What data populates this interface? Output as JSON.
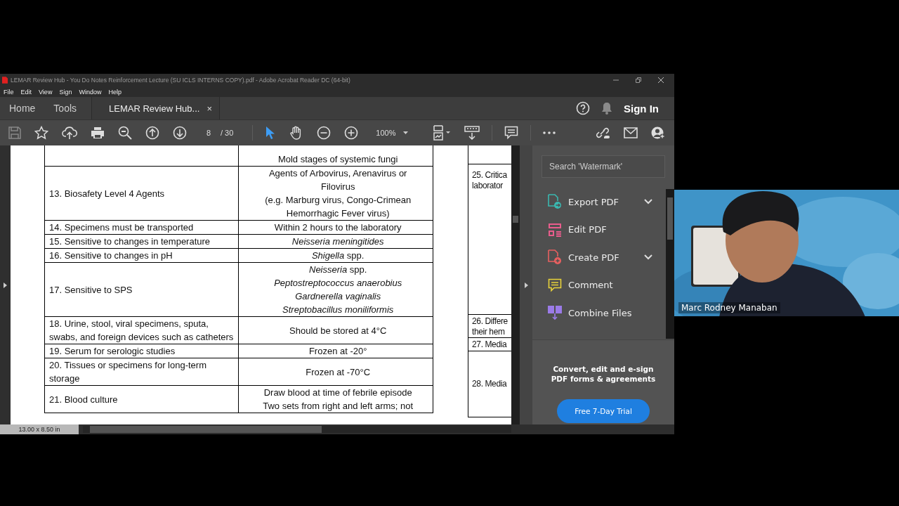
{
  "window": {
    "title": "LEMAR Review Hub - You Do Notes Reinforcement Lecture (SU ICLS INTERNS COPY).pdf - Adobe Acrobat Reader DC (64-bit)"
  },
  "menu": [
    "File",
    "Edit",
    "View",
    "Sign",
    "Window",
    "Help"
  ],
  "tabs": [
    {
      "label": "Home",
      "selected": false,
      "closable": false
    },
    {
      "label": "Tools",
      "selected": false,
      "closable": false
    },
    {
      "label": "LEMAR Review Hub...",
      "selected": true,
      "closable": true,
      "close": "×"
    }
  ],
  "sign_in": "Sign In",
  "toolbar": {
    "page": "8",
    "page_count": "/ 30",
    "zoom": "100%",
    "tools": [
      {
        "kind": "select",
        "selected": true
      },
      {
        "kind": "hand",
        "selected": false
      }
    ]
  },
  "table": {
    "rows": [
      {
        "answer": [
          {
            "text": "Mold stages of systemic fungi",
            "italic": false
          }
        ]
      },
      {
        "item": "13. Biosafety Level 4 Agents",
        "answer": [
          {
            "text": "Agents of Arbovirus, Arenavirus or",
            "italic": false
          },
          {
            "text": "Filovirus",
            "italic": false
          },
          {
            "text": "(e.g. Marburg virus, Congo-Crimean",
            "italic": false
          },
          {
            "text": "Hemorrhagic Fever virus)",
            "italic": false
          }
        ]
      },
      {
        "item": "14. Specimens must be transported",
        "answer": [
          {
            "text": "Within 2 hours to the laboratory",
            "italic": false
          }
        ]
      },
      {
        "item": "15. Sensitive to changes in temperature",
        "answer": [
          {
            "text": "Neisseria meningitides",
            "italic": true
          }
        ]
      },
      {
        "item": "16. Sensitive to changes in pH",
        "answer": [
          {
            "text": "*Shigella*  spp.",
            "italic": false
          }
        ]
      },
      {
        "item": "17. Sensitive to SPS",
        "answer": [
          {
            "text": "*Neisseria* spp.",
            "italic": false
          },
          {
            "text": "Peptostreptococcus anaerobius",
            "italic": true
          },
          {
            "text": "Gardnerella vaginalis",
            "italic": true
          },
          {
            "text": "Streptobacillus moniliformis",
            "italic": true
          }
        ]
      },
      {
        "item": "18. Urine, stool, viral specimens, sputa, swabs, and foreign devices such as catheters",
        "answer": [
          {
            "text": "Should be stored at 4°C",
            "italic": false
          }
        ]
      },
      {
        "item": "19. Serum for serologic studies",
        "answer": [
          {
            "text": "Frozen at -20°",
            "italic": false
          }
        ]
      },
      {
        "item": "20. Tissues or specimens for long-term storage",
        "answer": [
          {
            "text": "Frozen at -70°C",
            "italic": false
          }
        ]
      },
      {
        "item": "21. Blood culture",
        "answer": [
          {
            "text": "Draw blood at time of febrile episode",
            "italic": false
          },
          {
            "text": "Two sets from right and left arms; not",
            "italic": false
          }
        ]
      }
    ],
    "side_column": [
      {
        "lines": [
          "25. Critica",
          "laborator"
        ]
      },
      {
        "lines": [
          "26. Differe",
          "their hem"
        ]
      },
      {
        "lines": [
          "27. Media"
        ]
      },
      {
        "lines": [
          "28. Media"
        ]
      }
    ]
  },
  "page_size": "13.00 x 8.50 in",
  "tools_panel": {
    "search": {
      "placeholder": "Search 'Watermark'"
    },
    "items": [
      {
        "label": "Export PDF",
        "kind": "export",
        "color": "#3ab8b0",
        "expandable": true
      },
      {
        "label": "Edit PDF",
        "kind": "edit",
        "color": "#e85d8c",
        "expandable": false
      },
      {
        "label": "Create PDF",
        "kind": "create",
        "color": "#e86060",
        "expandable": true
      },
      {
        "label": "Comment",
        "kind": "comment",
        "color": "#e8d23a",
        "expandable": false
      },
      {
        "label": "Combine Files",
        "kind": "combine",
        "color": "#9b7be8",
        "expandable": false
      }
    ],
    "promo": "Convert, edit and e-sign PDF forms & agreements",
    "trial_button": "Free 7-Day Trial"
  },
  "video": {
    "kind": "picture",
    "name": "Marc Rodney Manaban"
  }
}
